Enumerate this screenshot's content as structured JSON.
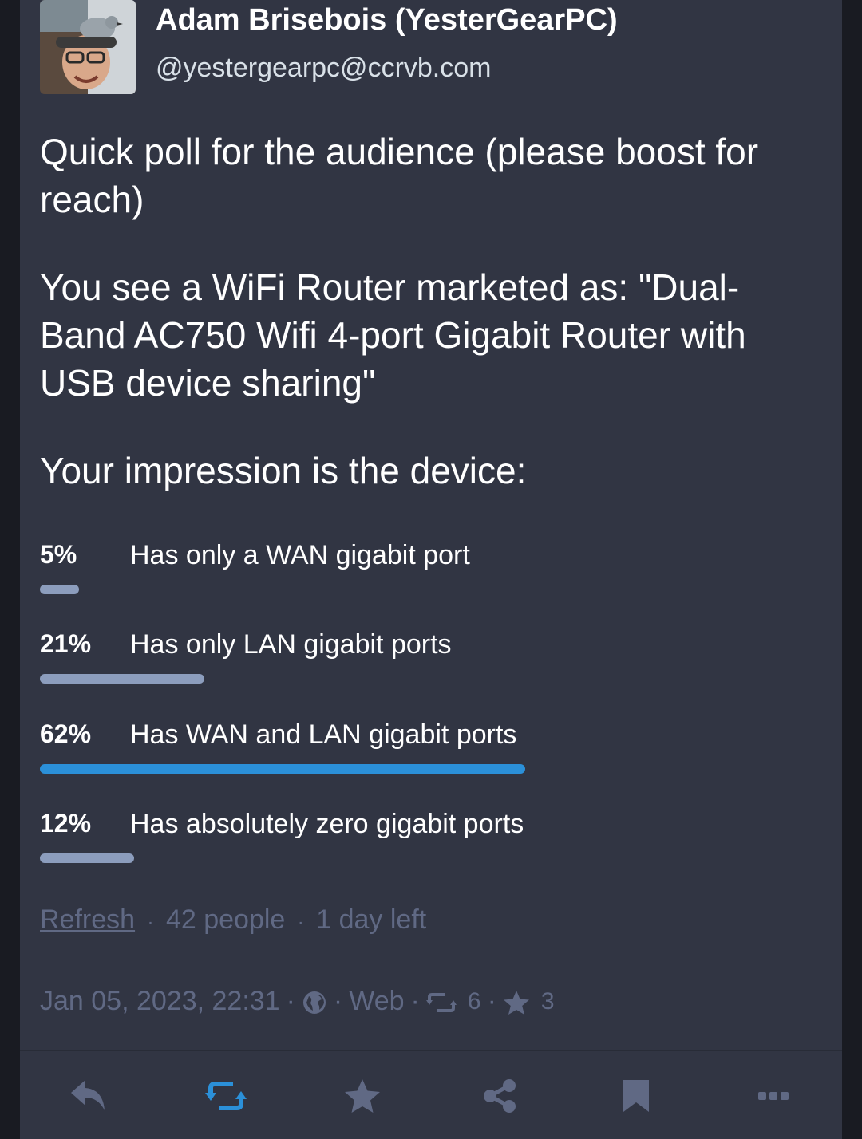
{
  "author": {
    "display_name": "Adam Brisebois (YesterGearPC)",
    "handle": "@yestergearpc@ccrvb.com"
  },
  "content": {
    "paragraphs": [
      "Quick poll for the audience (please boost for reach)",
      "You see a WiFi Router marketed as: \"Dual-Band AC750 Wifi 4-port Gigabit Router with USB device sharing\"",
      "Your impression is the device:"
    ]
  },
  "poll": {
    "options": [
      {
        "percent": "5%",
        "fraction": 0.05,
        "label": "Has only a WAN gigabit port",
        "leading": false
      },
      {
        "percent": "21%",
        "fraction": 0.21,
        "label": "Has only LAN gigabit ports",
        "leading": false
      },
      {
        "percent": "62%",
        "fraction": 0.62,
        "label": "Has WAN and LAN gigabit ports",
        "leading": true
      },
      {
        "percent": "12%",
        "fraction": 0.12,
        "label": "Has absolutely zero gigabit ports",
        "leading": false
      }
    ],
    "refresh_label": "Refresh",
    "voters": "42 people",
    "time_left": "1 day left",
    "separator": "·"
  },
  "meta": {
    "timestamp": "Jan 05, 2023, 22:31",
    "visibility_icon": "globe-icon",
    "application": "Web",
    "boost_count": "6",
    "favourite_count": "3"
  },
  "actions": [
    "reply-icon",
    "boost-icon",
    "favourite-icon",
    "share-icon",
    "bookmark-icon",
    "more-icon"
  ],
  "colors": {
    "background": "#191b22",
    "card": "#313543",
    "muted_text": "#606984",
    "bar": "#8c9dbd",
    "bar_leading": "#2b90d9",
    "boost_active": "#2b90d9"
  }
}
